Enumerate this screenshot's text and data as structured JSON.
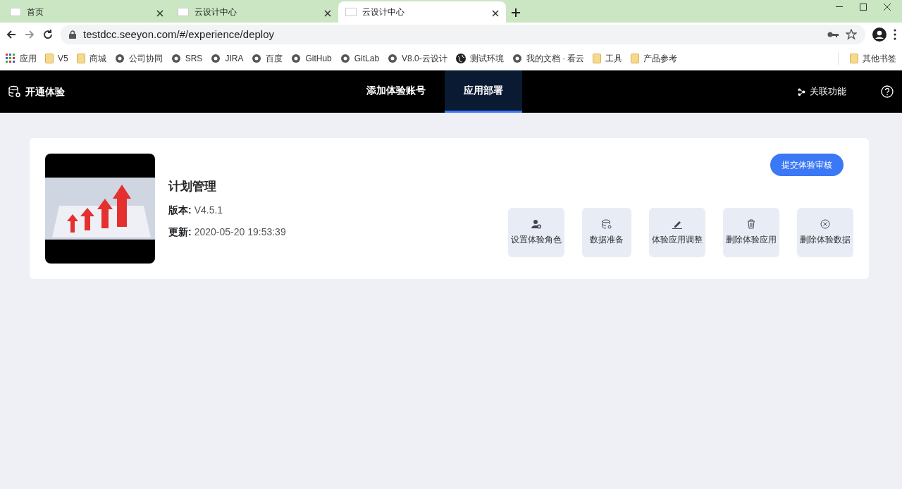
{
  "browser": {
    "tabs": [
      {
        "title": "首页",
        "selected": false
      },
      {
        "title": "云设计中心",
        "selected": false
      },
      {
        "title": "云设计中心",
        "selected": true
      }
    ],
    "url": "testdcc.seeyon.com/#/experience/deploy",
    "bookmarks": [
      {
        "label": "应用",
        "kind": "apps"
      },
      {
        "label": "V5",
        "kind": "folder"
      },
      {
        "label": "商城",
        "kind": "folder"
      },
      {
        "label": "公司协同",
        "kind": "site"
      },
      {
        "label": "SRS",
        "kind": "site"
      },
      {
        "label": "JIRA",
        "kind": "site"
      },
      {
        "label": "百度",
        "kind": "site"
      },
      {
        "label": "GitHub",
        "kind": "site"
      },
      {
        "label": "GitLab",
        "kind": "site"
      },
      {
        "label": "V8.0-云设计",
        "kind": "site"
      },
      {
        "label": "测试环境",
        "kind": "globe"
      },
      {
        "label": "我的文档 · 看云",
        "kind": "site"
      },
      {
        "label": "工具",
        "kind": "folder"
      },
      {
        "label": "产品参考",
        "kind": "folder"
      }
    ],
    "other_bookmarks": "其他书签"
  },
  "app": {
    "brand": "开通体验",
    "nav": [
      {
        "label": "添加体验账号",
        "selected": false
      },
      {
        "label": "应用部署",
        "selected": true
      }
    ],
    "related": "关联功能"
  },
  "card": {
    "title": "计划管理",
    "version_label": "版本:",
    "version": "V4.5.1",
    "updated_label": "更新:",
    "updated": "2020-05-20 19:53:39",
    "submit": "提交体验审核",
    "actions": [
      {
        "label": "设置体验角色",
        "kind": "role"
      },
      {
        "label": "数据准备",
        "kind": "data"
      },
      {
        "label": "体验应用调整",
        "kind": "edit"
      },
      {
        "label": "删除体验应用",
        "kind": "trash"
      },
      {
        "label": "删除体验数据",
        "kind": "remove"
      }
    ]
  }
}
